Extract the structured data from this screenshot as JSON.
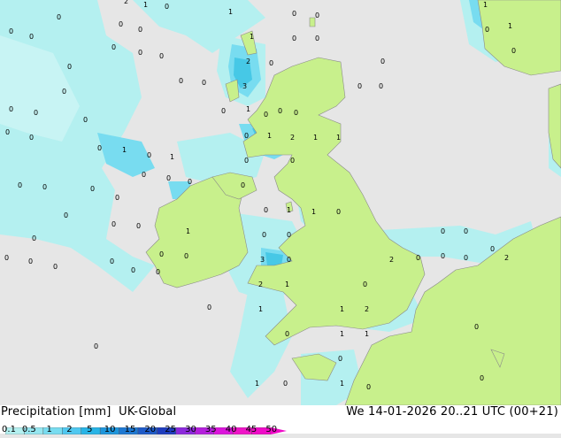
{
  "title": {
    "parameter": "Precipitation [mm]",
    "model": "UK-Global",
    "datetime": "We 14-01-2026 20..21 UTC (00+21)"
  },
  "legend": {
    "labels": [
      "0.1",
      "0.5",
      "1",
      "2",
      "5",
      "10",
      "15",
      "20",
      "25",
      "30",
      "35",
      "40",
      "45",
      "50"
    ],
    "colors": [
      "#b4f0f0",
      "#96e6f0",
      "#78dcf0",
      "#50c8f0",
      "#28b4e6",
      "#1e96dc",
      "#1e78d2",
      "#1e5ac8",
      "#1e3cbe",
      "#8c28dc",
      "#b41edc",
      "#dc14dc",
      "#f014c8",
      "#f00ac8"
    ]
  },
  "colors": {
    "sea": "#e6e6e6",
    "land": "#c8f08c",
    "precip_light": "#b4f0f0",
    "precip_moderate": "#78dcf0",
    "precip_heavy": "#46c8e6"
  },
  "point_labels": [
    "0",
    "1",
    "2",
    "3"
  ]
}
